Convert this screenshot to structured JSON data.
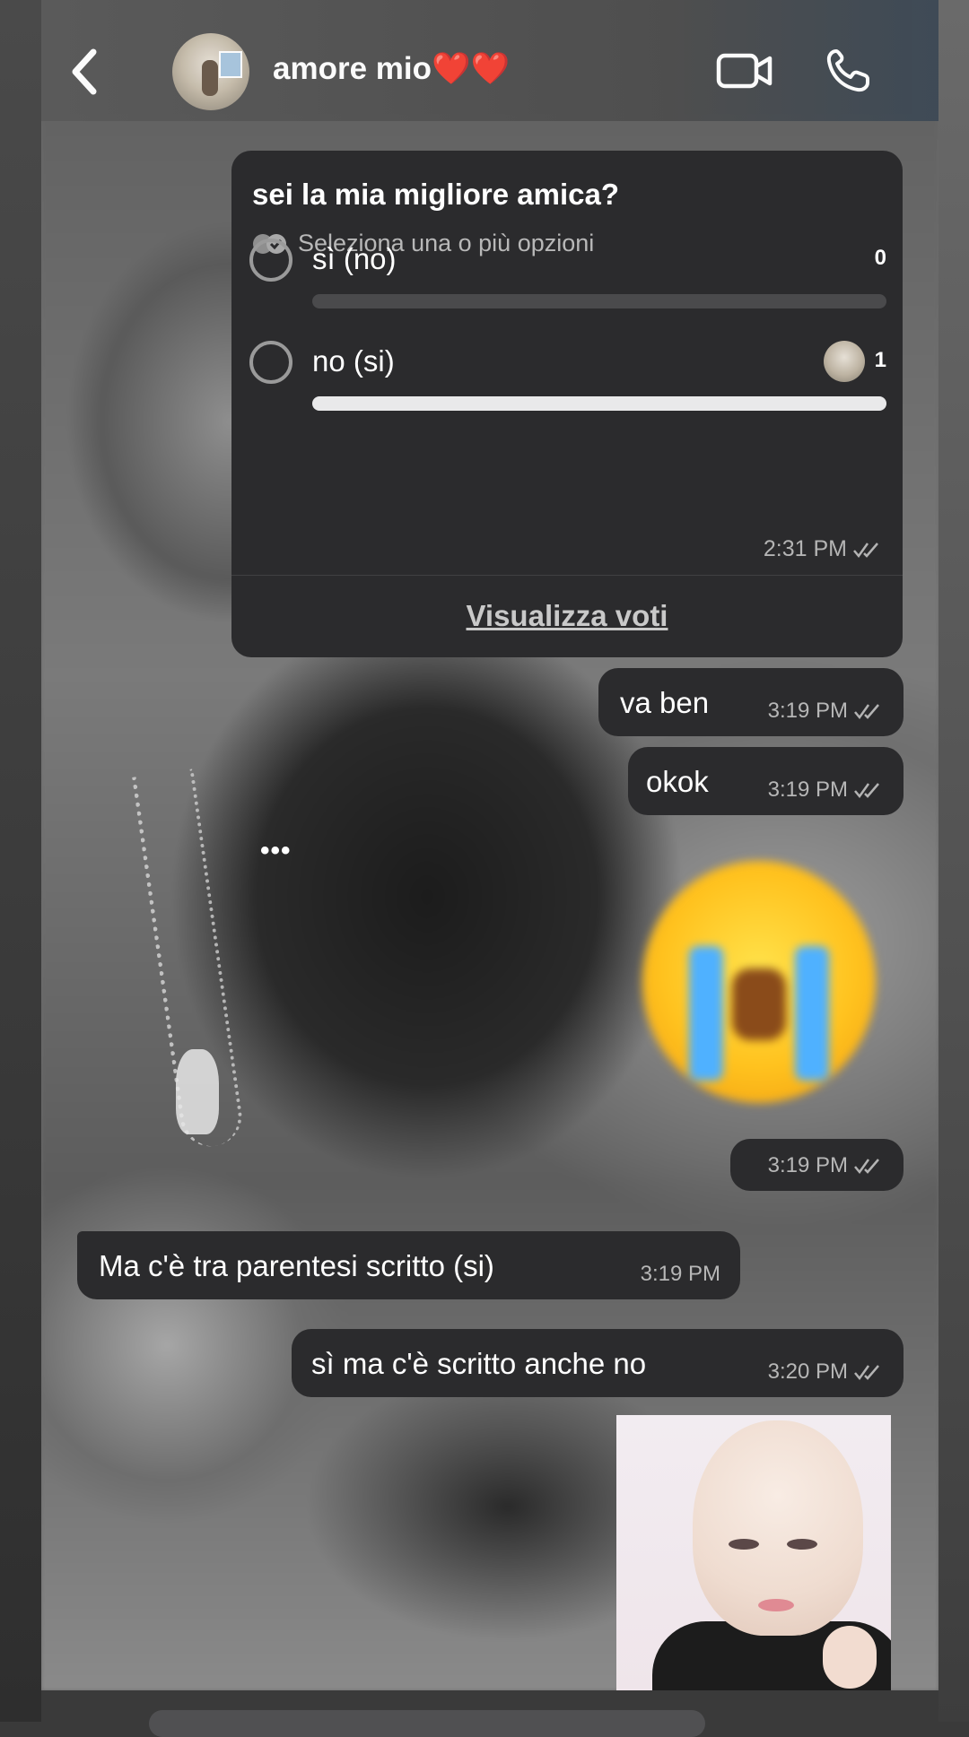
{
  "header": {
    "contact_name": "amore mio❤️❤️",
    "back_icon": "chevron-left-icon",
    "video_icon": "video-camera-icon",
    "call_icon": "phone-icon"
  },
  "poll": {
    "question": "sei la mia migliore amica?",
    "subtitle": "Seleziona una o più opzioni",
    "options": [
      {
        "label": "sì (no)",
        "votes": "0",
        "fraction": 0
      },
      {
        "label": "no (si)",
        "votes": "1",
        "fraction": 1
      }
    ],
    "time": "2:31 PM",
    "view_votes_label": "Visualizza voti"
  },
  "messages": [
    {
      "text": "va ben",
      "time": "3:19 PM",
      "direction": "outgoing"
    },
    {
      "text": "okok",
      "time": "3:19 PM",
      "direction": "outgoing"
    },
    {
      "text": "😭",
      "time": "3:19 PM",
      "direction": "outgoing",
      "kind": "emoji"
    },
    {
      "text": "Ma c'è tra parentesi scritto (si)",
      "time": "3:19 PM",
      "direction": "incoming"
    },
    {
      "text": "sì ma c'è scritto anche no",
      "time": "3:20 PM",
      "direction": "outgoing"
    }
  ],
  "typing_indicator": "•••",
  "colors": {
    "bubble": "#2b2b2d",
    "poll_bar_fill": "#e9e9ea",
    "poll_bar_track": "#4a4a4c"
  }
}
